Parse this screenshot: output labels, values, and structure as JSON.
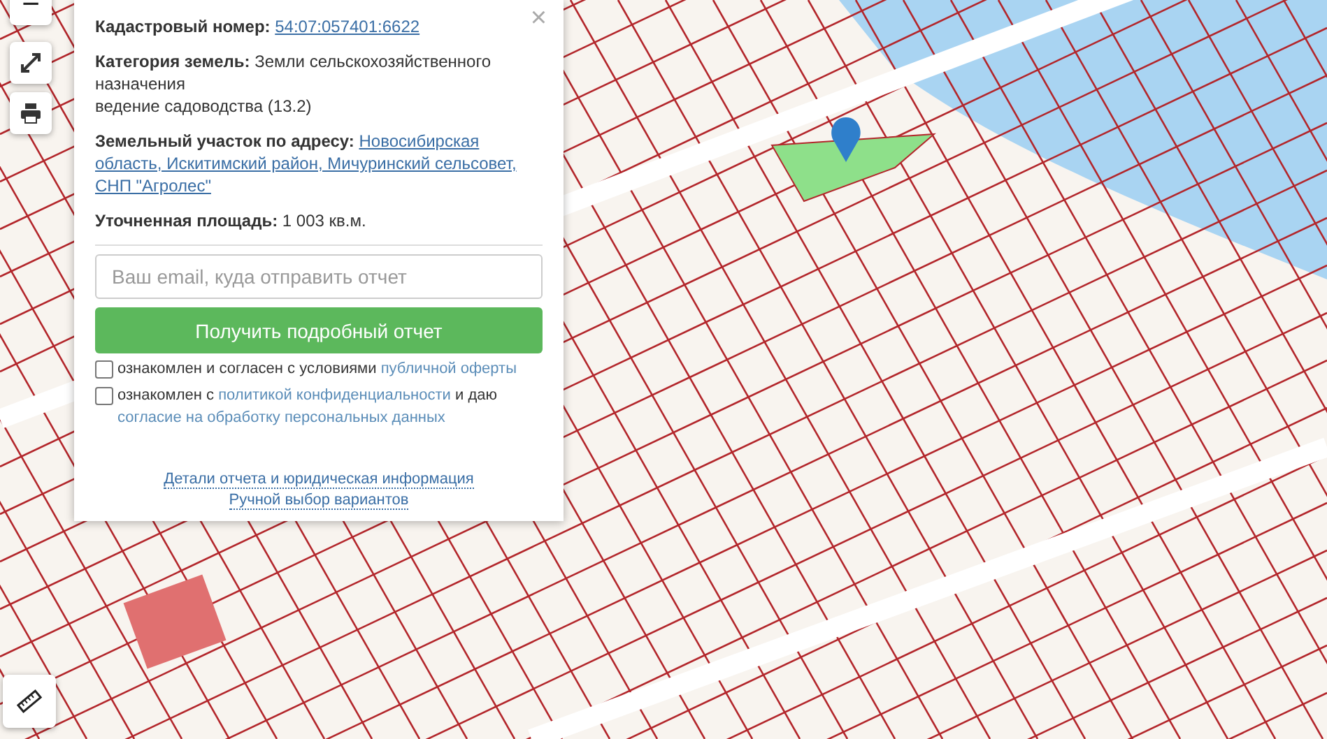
{
  "map_controls": {
    "zoom_out": "−"
  },
  "popup": {
    "close": "×",
    "cadastral": {
      "label": "Кадастровый номер:",
      "value": "54:07:057401:6622"
    },
    "category": {
      "label": "Категория земель:",
      "lines": [
        "Земли сельскохозяйственного назначения",
        "ведение садоводства (13.2)"
      ]
    },
    "address": {
      "label": "Земельный участок по адресу:",
      "lines": [
        "Новосибирская",
        "область, Искитимский район, Мичуринский сельсовет,",
        "СНП \"Агролес\""
      ]
    },
    "area": {
      "label": "Уточненная площадь:",
      "value": "1 003 кв.м."
    },
    "email": {
      "placeholder": "Ваш email, куда отправить отчет"
    },
    "submit": "Получить подробный отчет",
    "agreements": [
      {
        "checked": false,
        "parts": [
          {
            "kind": "text",
            "text": "ознакомлен и согласен с условиями "
          },
          {
            "kind": "link",
            "text": "публичной оферты"
          }
        ]
      },
      {
        "checked": false,
        "parts": [
          {
            "kind": "text",
            "text": "ознакомлен с "
          },
          {
            "kind": "link",
            "text": "политикой конфиденциальности"
          },
          {
            "kind": "text",
            "text": " и даю "
          },
          {
            "kind": "link",
            "text": "согласие на обработку персональных данных"
          }
        ]
      }
    ],
    "links": [
      "Детали отчета и юридическая информация",
      "Ручной выбор вариантов"
    ]
  }
}
